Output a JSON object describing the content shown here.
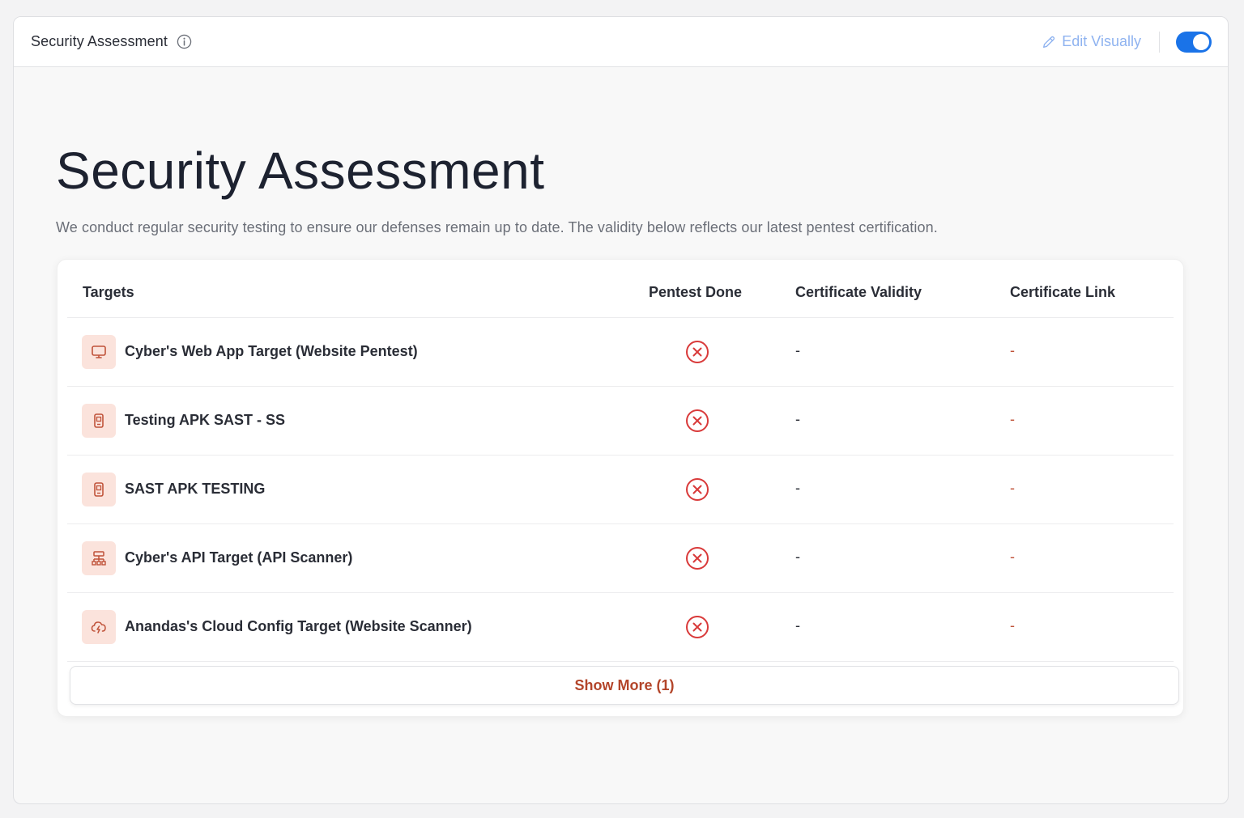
{
  "header": {
    "title": "Security Assessment",
    "edit_label": "Edit Visually",
    "toggle_on": true,
    "accent_color": "#1a73e8"
  },
  "main": {
    "title": "Security Assessment",
    "description": "We conduct regular security testing to ensure our defenses remain up to date. The validity below reflects our latest pentest certification."
  },
  "table": {
    "columns": [
      "Targets",
      "Pentest Done",
      "Certificate Validity",
      "Certificate Link"
    ],
    "rows": [
      {
        "icon": "monitor-icon",
        "name": "Cyber's Web App Target (Website Pentest)",
        "pentest_done": "failed",
        "validity": "-",
        "link": "-"
      },
      {
        "icon": "mobile-app-icon",
        "name": "Testing APK SAST - SS",
        "pentest_done": "failed",
        "validity": "-",
        "link": "-"
      },
      {
        "icon": "mobile-app-icon",
        "name": "SAST APK TESTING",
        "pentest_done": "failed",
        "validity": "-",
        "link": "-"
      },
      {
        "icon": "api-network-icon",
        "name": "Cyber's API Target (API Scanner)",
        "pentest_done": "failed",
        "validity": "-",
        "link": "-"
      },
      {
        "icon": "cloud-icon",
        "name": "Anandas's Cloud Config Target (Website Scanner)",
        "pentest_done": "failed",
        "validity": "-",
        "link": "-"
      }
    ],
    "show_more_label": "Show More (1)",
    "status_fail_color": "#d93a3a",
    "icon_bg_color": "#fbe3dc"
  }
}
